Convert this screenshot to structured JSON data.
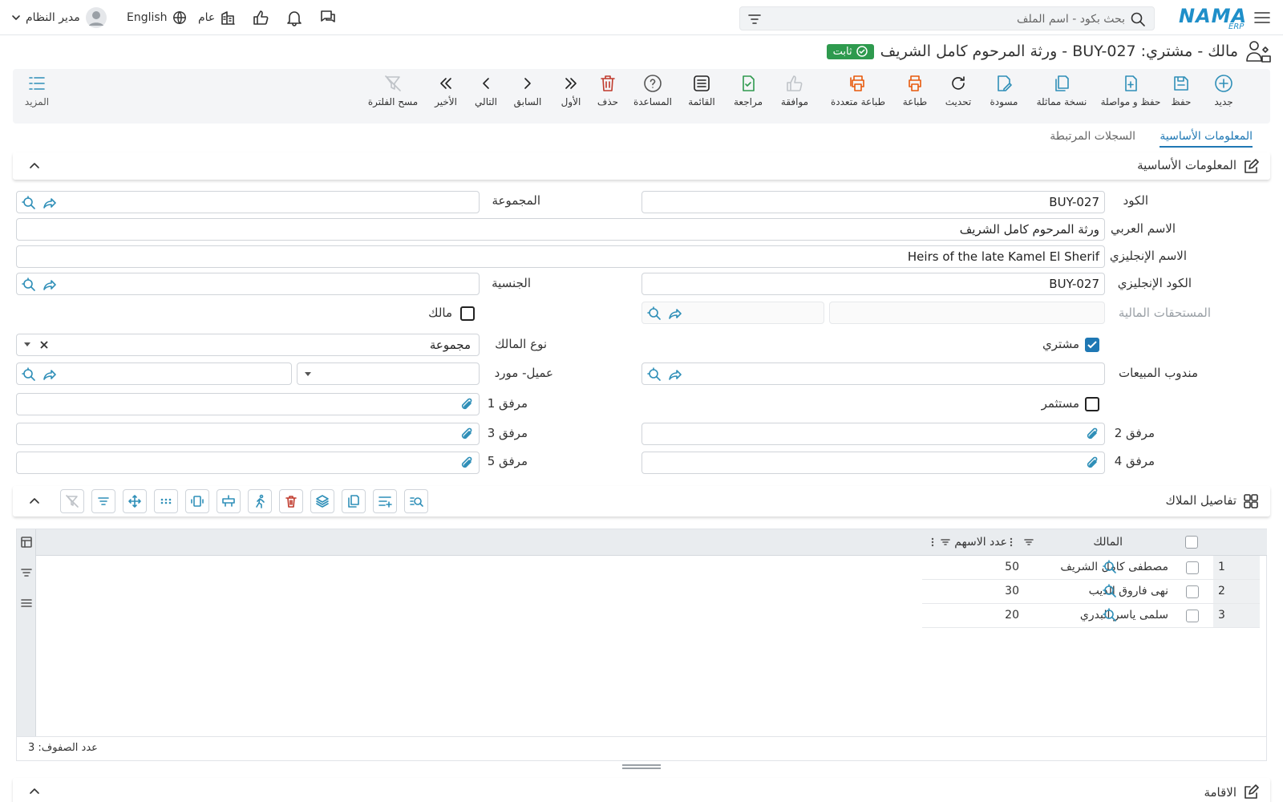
{
  "topbar": {
    "brand": "NAMA",
    "brand_sub": "ERP",
    "search_placeholder": "بحث بكود - اسم الملف",
    "user_name": "مدير النظام",
    "language": "English",
    "scope": "عام"
  },
  "page": {
    "title": "مالك - مشتري: BUY-027 - ورثة المرحوم كامل الشريف",
    "status": "ثابت"
  },
  "toolbar": {
    "items": [
      {
        "label": "جديد",
        "icon": "plus-circle-icon"
      },
      {
        "label": "حفظ",
        "icon": "save-icon"
      },
      {
        "label": "حفظ و مواصلة",
        "icon": "save-continue-icon"
      },
      {
        "label": "نسخة مماثلة",
        "icon": "copy-icon"
      },
      {
        "label": "مسودة",
        "icon": "draft-icon"
      },
      {
        "label": "تحديث",
        "icon": "refresh-icon"
      },
      {
        "label": "طباعة",
        "icon": "print-icon"
      },
      {
        "label": "طباعة متعددة",
        "icon": "multi-print-icon"
      },
      {
        "label": "موافقة",
        "icon": "thumb-up-icon"
      },
      {
        "label": "مراجعة",
        "icon": "review-icon"
      },
      {
        "label": "القائمة",
        "icon": "list-icon"
      },
      {
        "label": "المساعدة",
        "icon": "help-icon"
      },
      {
        "label": "حذف",
        "icon": "trash-icon"
      },
      {
        "label": "الأول",
        "icon": "first-icon"
      },
      {
        "label": "السابق",
        "icon": "prev-icon"
      },
      {
        "label": "التالي",
        "icon": "next-icon"
      },
      {
        "label": "الأخير",
        "icon": "last-icon"
      },
      {
        "label": "مسح الفلترة",
        "icon": "clear-filter-icon"
      }
    ],
    "more": "المزيد"
  },
  "tabs": [
    {
      "label": "المعلومات الأساسية",
      "active": true
    },
    {
      "label": "السجلات المرتبطة",
      "active": false
    }
  ],
  "basic_section": {
    "title": "المعلومات الأساسية"
  },
  "form": {
    "code_label": "الكود",
    "code_value": "BUY-027",
    "group_label": "المجموعة",
    "arabic_name_label": "الاسم العربي",
    "arabic_name_value": "ورثة المرحوم كامل الشريف",
    "english_name_label": "الاسم الإنجليزي",
    "english_name_value": "Heirs of the late Kamel El Sherif",
    "english_code_label": "الكود الإنجليزي",
    "english_code_value": "BUY-027",
    "nationality_label": "الجنسية",
    "receivables_label": "المستحقات المالية",
    "owner_check_label": "مالك",
    "owner_type_label": "نوع المالك",
    "owner_type_value": "مجموعة",
    "buyer_check_label": "مشتري",
    "sales_rep_label": "مندوب المبيعات",
    "customer_supplier_label": "عميل- مورد",
    "investor_label": "مستثمر",
    "attach1_label": "مرفق 1",
    "attach2_label": "مرفق 2",
    "attach3_label": "مرفق 3",
    "attach4_label": "مرفق 4",
    "attach5_label": "مرفق 5"
  },
  "owners_section": {
    "title": "تفاصيل الملاك",
    "col_owner": "المالك",
    "col_shares": "عدد الاسهم",
    "rows": [
      {
        "num": "1",
        "owner": "مصطفى كامل الشريف",
        "shares": "50"
      },
      {
        "num": "2",
        "owner": "نهى فاروق الديب",
        "shares": "30"
      },
      {
        "num": "3",
        "owner": "سلمى ياسر البدري",
        "shares": "20"
      }
    ],
    "row_count": "عدد الصفوف: 3"
  },
  "residence_section": {
    "title": "الاقامة"
  },
  "colors": {
    "accent": "#1f78b4",
    "icon_blue": "#2f8fb8",
    "status_green": "#2e9a4e",
    "print_orange": "#e8590c",
    "delete_red": "#c0392b"
  }
}
